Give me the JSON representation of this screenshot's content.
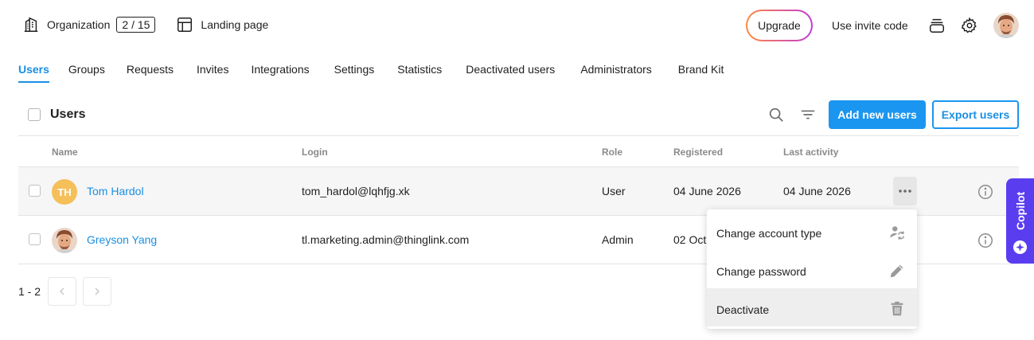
{
  "topbar": {
    "organization_label": "Organization",
    "organization_count": "2 / 15",
    "landing_label": "Landing page",
    "upgrade_label": "Upgrade",
    "invite_label": "Use invite code"
  },
  "tabs": [
    {
      "label": "Users",
      "active": true
    },
    {
      "label": "Groups"
    },
    {
      "label": "Requests"
    },
    {
      "label": "Invites"
    },
    {
      "label": "Integrations"
    },
    {
      "label": "Settings"
    },
    {
      "label": "Statistics"
    },
    {
      "label": "Deactivated users"
    },
    {
      "label": "Administrators"
    },
    {
      "label": "Brand Kit"
    }
  ],
  "users_header": {
    "title": "Users",
    "add_label": "Add new users",
    "export_label": "Export users"
  },
  "table": {
    "columns": {
      "name": "Name",
      "login": "Login",
      "role": "Role",
      "registered": "Registered",
      "last_activity": "Last activity"
    },
    "rows": [
      {
        "initials": "TH",
        "name": "Tom Hardol",
        "login": "tom_hardol@lqhfjg.xk",
        "role": "User",
        "registered": "04 June 2026",
        "last_activity": "04 June 2026"
      },
      {
        "name": "Greyson Yang",
        "login": "tl.marketing.admin@thinglink.com",
        "role": "Admin",
        "registered": "02 Oct"
      }
    ]
  },
  "pagination": {
    "range": "1 - 2"
  },
  "menu": {
    "items": [
      {
        "label": "Change account type",
        "icon": "person-swap-icon"
      },
      {
        "label": "Change password",
        "icon": "pencil-icon"
      },
      {
        "label": "Deactivate",
        "icon": "trash-icon",
        "active": true
      }
    ]
  },
  "copilot": {
    "label": "Copilot"
  },
  "colors": {
    "accent": "#1a96f0",
    "link": "#1a8fe3",
    "copilot": "#5b3df0",
    "avatar_th": "#f5bf5a"
  }
}
